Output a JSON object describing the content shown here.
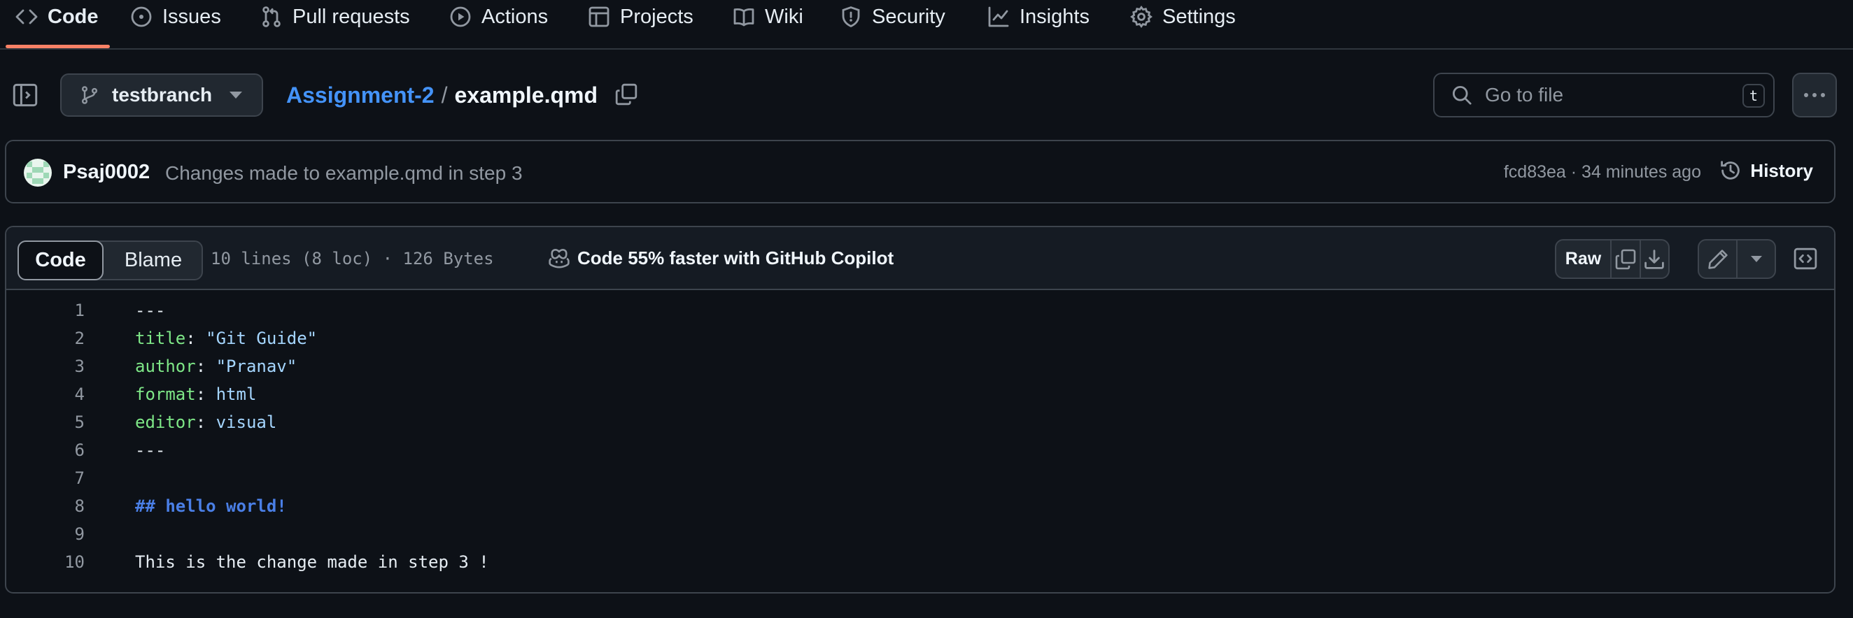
{
  "nav": {
    "tabs": [
      {
        "label": "Code",
        "icon": "code-icon",
        "active": true
      },
      {
        "label": "Issues",
        "icon": "issue-opened-icon"
      },
      {
        "label": "Pull requests",
        "icon": "git-pull-request-icon"
      },
      {
        "label": "Actions",
        "icon": "play-icon"
      },
      {
        "label": "Projects",
        "icon": "table-icon"
      },
      {
        "label": "Wiki",
        "icon": "book-icon"
      },
      {
        "label": "Security",
        "icon": "shield-icon"
      },
      {
        "label": "Insights",
        "icon": "graph-icon"
      },
      {
        "label": "Settings",
        "icon": "gear-icon"
      }
    ]
  },
  "header": {
    "branch": "testbranch",
    "repo": "Assignment-2",
    "separator": "/",
    "filename": "example.qmd",
    "goto_placeholder": "Go to file",
    "goto_shortcut": "t"
  },
  "commit": {
    "author": "Psaj0002",
    "message": "Changes made to example.qmd in step 3",
    "sha": "fcd83ea",
    "dot": " · ",
    "time": "34 minutes ago",
    "history_label": "History"
  },
  "file": {
    "tab_code": "Code",
    "tab_blame": "Blame",
    "info": "10 lines (8 loc) · 126 Bytes",
    "copilot": "Code 55% faster with GitHub Copilot",
    "raw_label": "Raw",
    "lines": [
      {
        "n": "1",
        "parts": [
          {
            "t": "---",
            "c": ""
          }
        ]
      },
      {
        "n": "2",
        "parts": [
          {
            "t": "title",
            "c": "k"
          },
          {
            "t": ": ",
            "c": ""
          },
          {
            "t": "\"Git Guide\"",
            "c": "s"
          }
        ]
      },
      {
        "n": "3",
        "parts": [
          {
            "t": "author",
            "c": "k"
          },
          {
            "t": ": ",
            "c": ""
          },
          {
            "t": "\"Pranav\"",
            "c": "s"
          }
        ]
      },
      {
        "n": "4",
        "parts": [
          {
            "t": "format",
            "c": "k"
          },
          {
            "t": ": ",
            "c": ""
          },
          {
            "t": "html",
            "c": "v"
          }
        ]
      },
      {
        "n": "5",
        "parts": [
          {
            "t": "editor",
            "c": "k"
          },
          {
            "t": ": ",
            "c": ""
          },
          {
            "t": "visual",
            "c": "v"
          }
        ]
      },
      {
        "n": "6",
        "parts": [
          {
            "t": "---",
            "c": ""
          }
        ]
      },
      {
        "n": "7",
        "parts": [
          {
            "t": "",
            "c": ""
          }
        ]
      },
      {
        "n": "8",
        "parts": [
          {
            "t": "## hello world!",
            "c": "h"
          }
        ]
      },
      {
        "n": "9",
        "parts": [
          {
            "t": "",
            "c": ""
          }
        ]
      },
      {
        "n": "10",
        "parts": [
          {
            "t": "This is the change made in step 3 !",
            "c": ""
          }
        ]
      }
    ]
  },
  "colors": {
    "background": "#0d1117",
    "accent_underline": "#f78166",
    "link": "#4493f8",
    "yaml_key": "#7ee787",
    "string": "#a5d6ff"
  }
}
